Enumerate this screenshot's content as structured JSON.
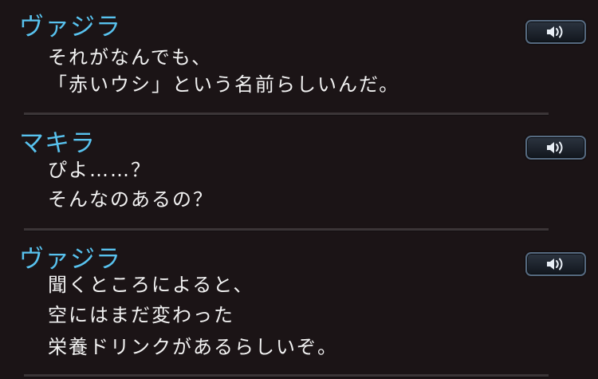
{
  "backlog": {
    "entries": [
      {
        "speaker": "ヴァジラ",
        "lines": [
          "それがなんでも、",
          "「赤いウシ」という名前らしいんだ。"
        ]
      },
      {
        "speaker": "マキラ",
        "lines": [
          "ぴよ……？",
          "そんなのあるの？"
        ]
      },
      {
        "speaker": "ヴァジラ",
        "lines": [
          "聞くところによると、",
          "空にはまだ変わった",
          "栄養ドリンクがあるらしいぞ。"
        ]
      }
    ],
    "voice_icon": "speaker-icon"
  },
  "colors": {
    "background": "#1b1416",
    "speaker_name": "#58c2ee",
    "dialogue_text": "#f2f2f2",
    "button_border": "#566a80",
    "divider": "#3b3537"
  }
}
